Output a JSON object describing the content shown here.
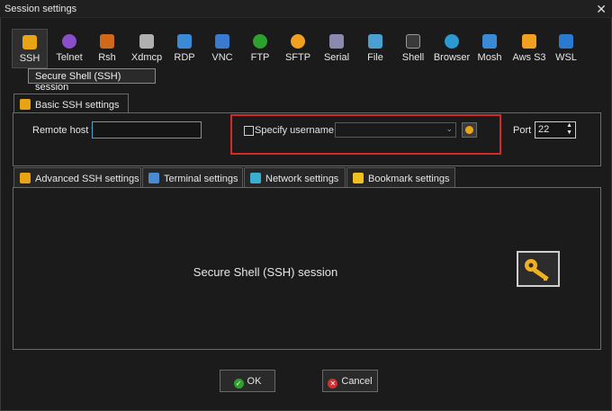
{
  "window": {
    "title": "Session settings",
    "close_glyph": "✕"
  },
  "toolbar": {
    "items": [
      {
        "label": "SSH",
        "icon": "ssh-key-icon",
        "color": "#e9a413",
        "active": true
      },
      {
        "label": "Telnet",
        "icon": "telnet-icon",
        "color": "#8a4fc8"
      },
      {
        "label": "Rsh",
        "icon": "rsh-icon",
        "color": "#d06a1a"
      },
      {
        "label": "Xdmcp",
        "icon": "xdmcp-icon",
        "color": "#b0b0b0"
      },
      {
        "label": "RDP",
        "icon": "rdp-icon",
        "color": "#3a8ad6"
      },
      {
        "label": "VNC",
        "icon": "vnc-icon",
        "color": "#3a7ad0"
      },
      {
        "label": "FTP",
        "icon": "ftp-icon",
        "color": "#2fa02f"
      },
      {
        "label": "SFTP",
        "icon": "sftp-icon",
        "color": "#f0a020"
      },
      {
        "label": "Serial",
        "icon": "serial-icon",
        "color": "#8a8ab0"
      },
      {
        "label": "File",
        "icon": "file-icon",
        "color": "#4aa0d0"
      },
      {
        "label": "Shell",
        "icon": "shell-icon",
        "color": "#3a3a3a"
      },
      {
        "label": "Browser",
        "icon": "browser-icon",
        "color": "#2a9ad0"
      },
      {
        "label": "Mosh",
        "icon": "mosh-icon",
        "color": "#3a8ad6"
      },
      {
        "label": "Aws S3",
        "icon": "aws-s3-icon",
        "color": "#f0a020"
      },
      {
        "label": "WSL",
        "icon": "wsl-icon",
        "color": "#2a7ad0"
      }
    ],
    "tooltip": "Secure Shell (SSH) session"
  },
  "basic_tab": {
    "label": "Basic SSH settings",
    "remote_host_label": "Remote host *",
    "remote_host_value": "",
    "specify_username_label": "Specify username",
    "specify_username_checked": false,
    "username_value": "",
    "port_label": "Port",
    "port_value": "22"
  },
  "sub_tabs": [
    {
      "label": "Advanced SSH settings",
      "icon": "key-icon",
      "color": "#e9a413"
    },
    {
      "label": "Terminal settings",
      "icon": "terminal-icon",
      "color": "#4a8ad0"
    },
    {
      "label": "Network settings",
      "icon": "network-icon",
      "color": "#3ab0d0"
    },
    {
      "label": "Bookmark settings",
      "icon": "star-icon",
      "color": "#f0c020"
    }
  ],
  "session_panel": {
    "description": "Secure Shell (SSH) session"
  },
  "buttons": {
    "ok": "OK",
    "cancel": "Cancel"
  },
  "colors": {
    "highlight_border": "#d42a2a",
    "accent_input": "#4fa1c9",
    "ok_green": "#2fa02f",
    "cancel_red": "#d03030"
  }
}
